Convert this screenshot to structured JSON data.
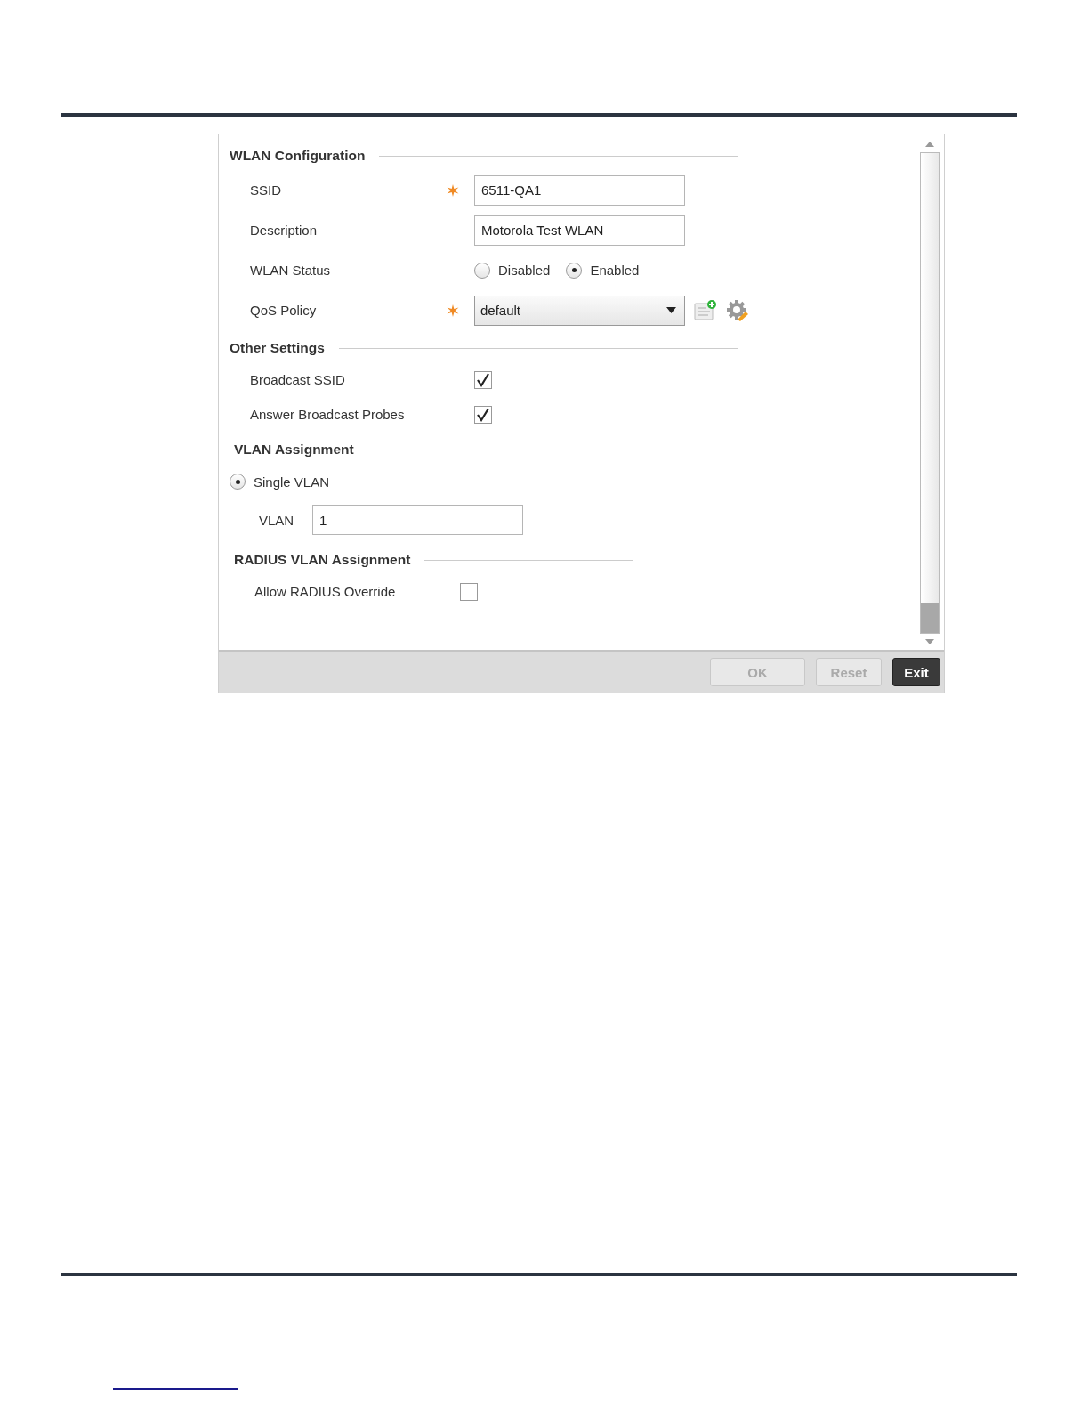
{
  "sections": [
    {
      "title": "WLAN Configuration",
      "fields": [
        {
          "kind": "text",
          "label": "SSID",
          "required": true,
          "value": "6511-QA1"
        },
        {
          "kind": "text",
          "label": "Description",
          "required": false,
          "value": "Motorola Test WLAN"
        },
        {
          "kind": "radio",
          "label": "WLAN Status",
          "options": [
            {
              "label": "Disabled",
              "selected": false
            },
            {
              "label": "Enabled",
              "selected": true
            }
          ]
        },
        {
          "kind": "select",
          "label": "QoS Policy",
          "required": true,
          "value": "default"
        }
      ]
    },
    {
      "title": "Other Settings",
      "fields": [
        {
          "kind": "checkbox",
          "label": "Broadcast SSID",
          "checked": true
        },
        {
          "kind": "checkbox",
          "label": "Answer Broadcast Probes",
          "checked": true
        }
      ]
    },
    {
      "title": "VLAN Assignment",
      "fields": [
        {
          "kind": "option",
          "label": "Single VLAN",
          "selected": true
        },
        {
          "kind": "subtext",
          "label": "VLAN",
          "value": "1"
        }
      ]
    },
    {
      "title": "RADIUS VLAN Assignment",
      "fields": [
        {
          "kind": "smallcheck",
          "label": "Allow RADIUS Override",
          "checked": false
        }
      ]
    }
  ],
  "buttons": [
    {
      "label": "OK",
      "disabled": true
    },
    {
      "label": "Reset",
      "disabled": true
    },
    {
      "label": "Exit",
      "disabled": false
    }
  ]
}
